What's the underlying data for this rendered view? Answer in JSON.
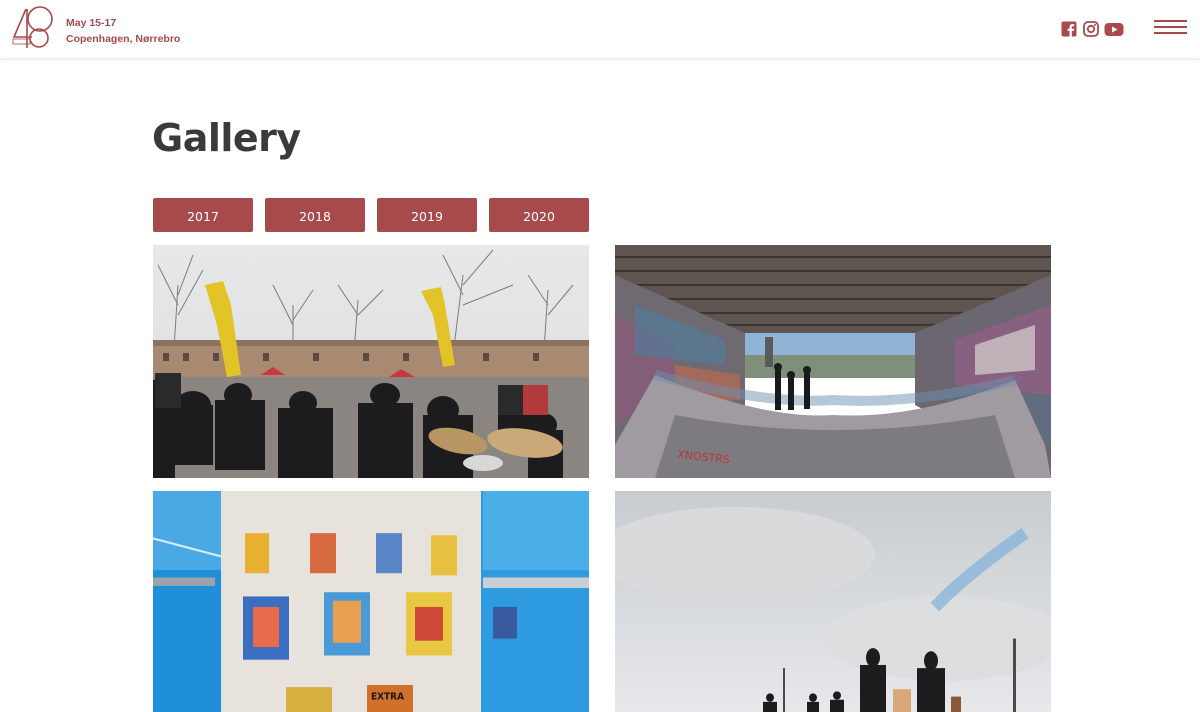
{
  "header": {
    "logo_icon": "logo-48-circles",
    "date": "May 15-17",
    "location": "Copenhagen, Nørrebro",
    "social": [
      "facebook-icon",
      "instagram-icon",
      "youtube-icon"
    ],
    "menu_icon": "hamburger-menu-icon"
  },
  "main": {
    "title": "Gallery",
    "years": [
      "2017",
      "2018",
      "2019",
      "2020"
    ]
  },
  "gallery": {
    "photos": [
      "concert-photo",
      "skatepark-photo",
      "poster-exhibition-photo",
      "crowd-sky-photo"
    ]
  },
  "colors": {
    "accent": "#a8494b",
    "title": "#3a3a3a"
  }
}
